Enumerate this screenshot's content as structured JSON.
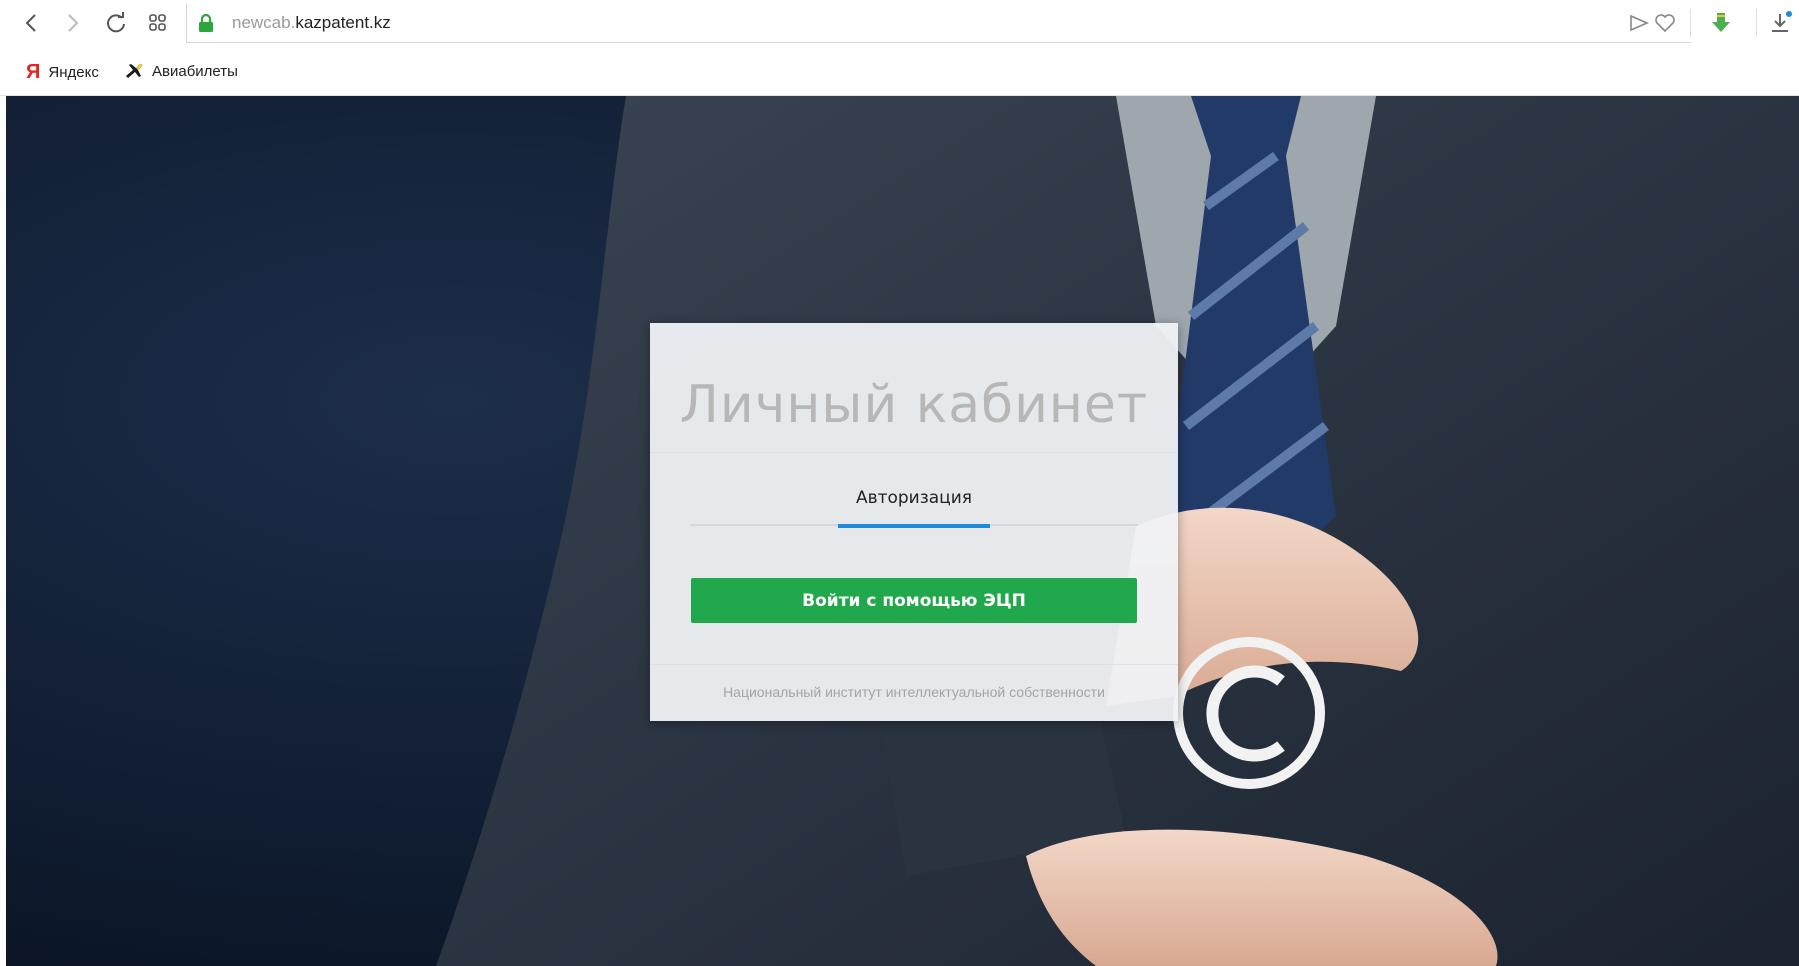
{
  "browser": {
    "url_subdomain": "newcab.",
    "url_domain": "kazpatent.kz",
    "bookmarks": [
      {
        "label": "Яндекс",
        "icon": "yandex-icon"
      },
      {
        "label": "Авиабилеты",
        "icon": "plane-icon"
      }
    ]
  },
  "card": {
    "title": "Личный кабинет",
    "tab_label": "Авторизация",
    "login_button": "Войти с помощью ЭЦП",
    "footer": "Национальный институт интеллектуальной собственности"
  },
  "colors": {
    "accent_blue": "#1f8ad8",
    "button_green": "#22a84c",
    "lock_green": "#2aa63a"
  }
}
